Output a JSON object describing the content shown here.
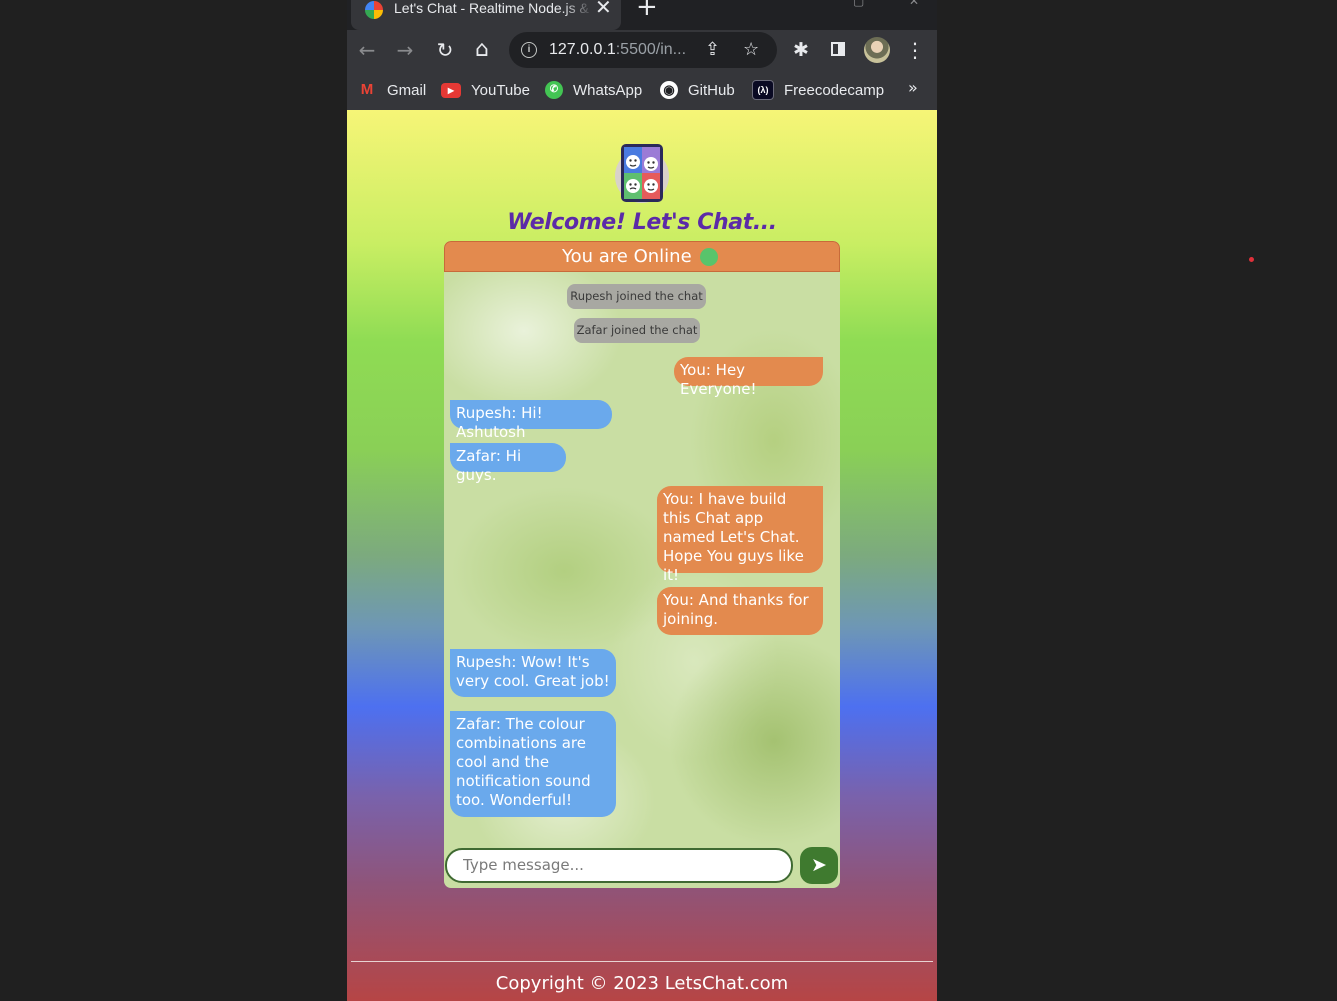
{
  "browser": {
    "tab_title": "Let's Chat - Realtime Node.js & Socket.io",
    "tab_close": "✕",
    "new_tab": "+",
    "url_host": "127.0.0.1",
    "url_rest": ":5500/in...",
    "nav": {
      "back": "←",
      "forward": "→",
      "reload": "↻",
      "home": "⌂"
    },
    "icons": {
      "share": "⇪",
      "bookmark_star": "☆",
      "extensions": "✱",
      "menu": "⋮"
    }
  },
  "bookmarks": [
    {
      "label": "Gmail",
      "icon": "gmail-icon",
      "glyph": "M",
      "color": "#ea4335"
    },
    {
      "label": "YouTube",
      "icon": "youtube-icon",
      "glyph": "▶",
      "color": "#e53935"
    },
    {
      "label": "WhatsApp",
      "icon": "whatsapp-icon",
      "glyph": "✆",
      "color": "#43c553"
    },
    {
      "label": "GitHub",
      "icon": "github-icon",
      "glyph": "◉",
      "color": "#ffffff"
    },
    {
      "label": "Freecodecamp",
      "icon": "freecodecamp-icon",
      "glyph": "(λ)",
      "color": "#0a0a23"
    }
  ],
  "bookmarks_more": "»",
  "page": {
    "welcome": "Welcome! Let's Chat...",
    "status": "You are Online",
    "status_color": "#58c46b",
    "messages": [
      {
        "type": "system",
        "text": "Rupesh joined the chat"
      },
      {
        "type": "system",
        "text": "Zafar joined the chat"
      },
      {
        "type": "right",
        "text": "You: Hey Everyone!"
      },
      {
        "type": "left",
        "text": "Rupesh: Hi! Ashutosh"
      },
      {
        "type": "left",
        "text": "Zafar: Hi guys."
      },
      {
        "type": "right",
        "text": "You: I have build this Chat app named Let's Chat. Hope You guys like it!"
      },
      {
        "type": "right",
        "text": "You: And thanks for joining."
      },
      {
        "type": "left",
        "text": "Rupesh: Wow! It's very cool. Great job!"
      },
      {
        "type": "left",
        "text": "Zafar: The colour combinations are cool and the notification sound too. Wonderful!"
      }
    ],
    "input_placeholder": "Type message...",
    "send_glyph": "➤",
    "copyright": "Copyright © 2023 LetsChat.com"
  },
  "colors": {
    "outgoing": "#e38a4e",
    "incoming": "#6aa9ec",
    "system": "#a8a8a2",
    "send": "#3f7a2f"
  }
}
